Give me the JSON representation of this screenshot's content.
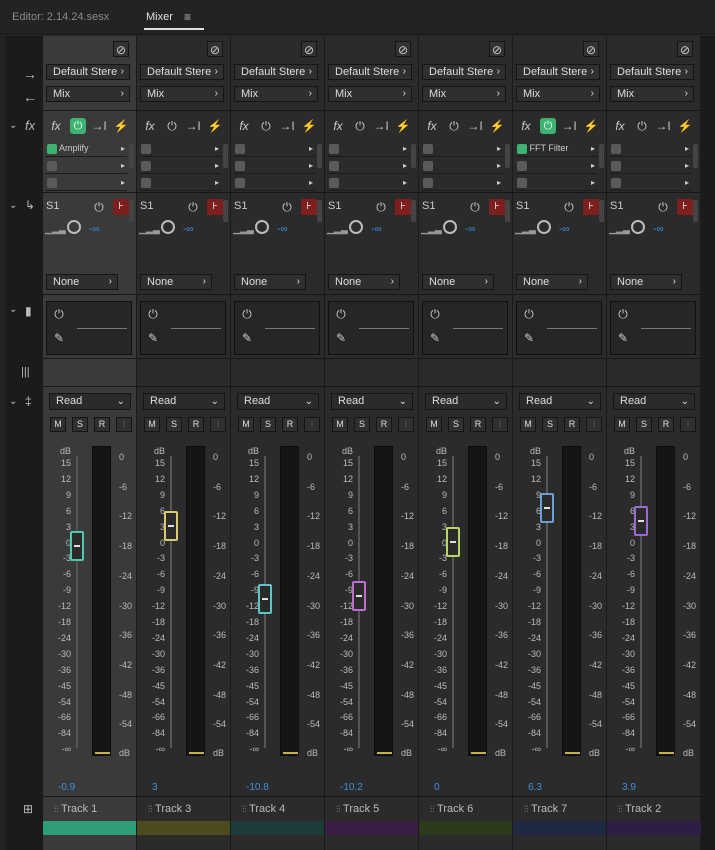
{
  "tabs": {
    "editor": "Editor: 2.14.24.sesx",
    "mixer": "Mixer"
  },
  "row_labels": {
    "fx": "fx"
  },
  "routing": {
    "input": "Default Stere",
    "output": "Mix"
  },
  "send": {
    "label": "S1",
    "value": "-∞",
    "destination": "None"
  },
  "automation": {
    "mode": "Read"
  },
  "buttons": {
    "m": "M",
    "s": "S",
    "r": "R",
    "i": "I"
  },
  "scale": {
    "left_header": "dB",
    "left": [
      "15",
      "12",
      "9",
      "6",
      "3",
      "0",
      "-3",
      "-6",
      "-9",
      "-12",
      "-18",
      "-24",
      "-30",
      "-36",
      "-45",
      "-54",
      "-66",
      "-84",
      "-∞"
    ],
    "right": [
      "0",
      "-6",
      "-12",
      "-18",
      "-24",
      "-30",
      "-36",
      "-42",
      "-48",
      "-54",
      "dB"
    ]
  },
  "colors": {
    "accent": "#3f8ee0",
    "active_power": "#3cb371",
    "meter": "#c7b23b"
  },
  "tracks": [
    {
      "name": "Track 1",
      "volume": "-0.9",
      "color": "#2e9e7a",
      "fader_color": "#4fc8b0",
      "fx_slot": "Amplify",
      "selected": true
    },
    {
      "name": "Track 3",
      "volume": "3",
      "color": "#4d4a1e",
      "fader_color": "#d6cc6e",
      "fx_slot": "",
      "selected": false
    },
    {
      "name": "Track 4",
      "volume": "-10.8",
      "color": "#1f3a3a",
      "fader_color": "#5cc6c6",
      "fx_slot": "",
      "selected": false
    },
    {
      "name": "Track 5",
      "volume": "-10.2",
      "color": "#3a1f44",
      "fader_color": "#c06ad4",
      "fx_slot": "",
      "selected": false
    },
    {
      "name": "Track 6",
      "volume": "0",
      "color": "#2e3a1e",
      "fader_color": "#b8d46a",
      "fx_slot": "",
      "selected": false
    },
    {
      "name": "Track 7",
      "volume": "6.3",
      "color": "#1e2a44",
      "fader_color": "#6aa0d4",
      "fx_slot": "FFT Filter",
      "selected": false
    },
    {
      "name": "Track 2",
      "volume": "3.9",
      "color": "#2e1e44",
      "fader_color": "#9c6ad4",
      "fx_slot": "",
      "selected": false
    }
  ]
}
